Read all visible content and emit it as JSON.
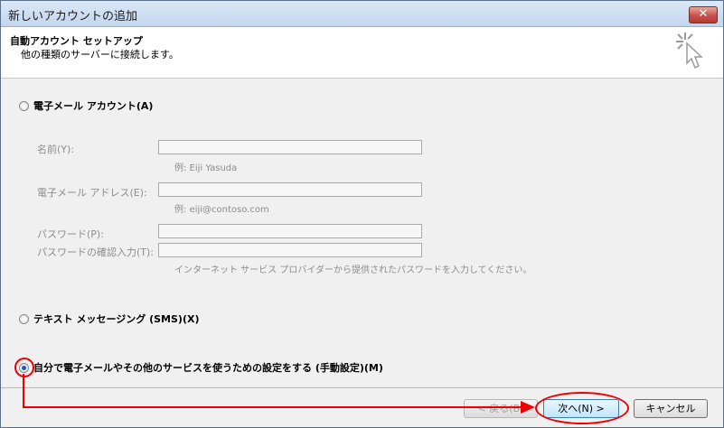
{
  "window": {
    "title": "新しいアカウントの追加",
    "close_glyph": "✕"
  },
  "header": {
    "title": "自動アカウント セットアップ",
    "subtitle": "他の種類のサーバーに接続します。"
  },
  "options": {
    "email_account": "電子メール アカウント(A)",
    "sms": "テキスト メッセージング (SMS)(X)",
    "manual": "自分で電子メールやその他のサービスを使うための設定をする (手動設定)(M)",
    "selected": "manual"
  },
  "form": {
    "name_label": "名前(Y):",
    "name_hint": "例: Eiji Yasuda",
    "email_label": "電子メール アドレス(E):",
    "email_hint": "例: eiji@contoso.com",
    "password_label": "パスワード(P):",
    "password_confirm_label": "パスワードの確認入力(T):",
    "password_hint": "インターネット サービス プロバイダーから提供されたパスワードを入力してください。"
  },
  "buttons": {
    "back": "< 戻る(B)",
    "next": "次へ(N) >",
    "cancel": "キャンセル"
  },
  "colors": {
    "annotation": "#e00000"
  }
}
